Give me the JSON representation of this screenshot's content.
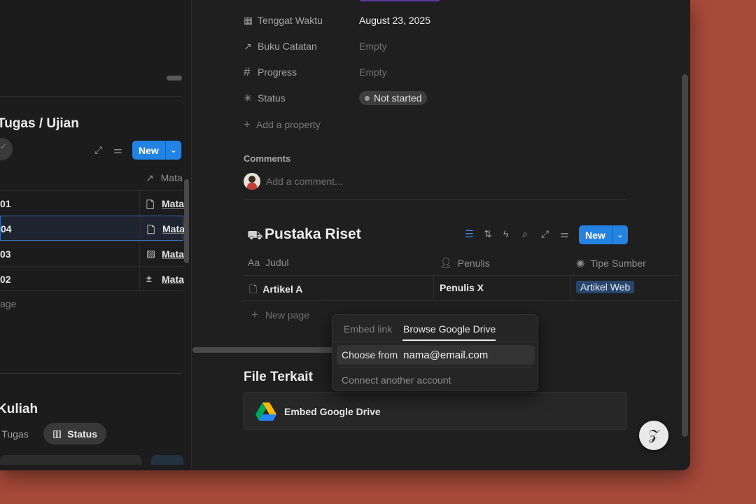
{
  "left_pane": {
    "title": "Tugas / Ujian",
    "new_label": "New",
    "column_header": "Mata",
    "rows": [
      {
        "id": "01",
        "icon": "page-icon",
        "glyph": "🗋",
        "mata": "Mata"
      },
      {
        "id": "04",
        "icon": "page-icon",
        "glyph": "🗋",
        "mata": "Mata"
      },
      {
        "id": "03",
        "icon": "chart-icon",
        "glyph": "▨",
        "mata": "Mata"
      },
      {
        "id": "02",
        "icon": "calc-icon",
        "glyph": "±",
        "mata": "Mata"
      }
    ],
    "new_page_fragment": "age",
    "section2_title": "Kuliah",
    "filter_fragment": "r Tugas",
    "status_pill": "Status"
  },
  "properties": [
    {
      "icon": "calendar-icon",
      "glyph": "▦",
      "name": "Tenggat Waktu",
      "value": "August 23, 2025",
      "empty": false
    },
    {
      "icon": "arrow-up-right-icon",
      "glyph": "↗",
      "name": "Buku Catatan",
      "value": "Empty",
      "empty": true
    },
    {
      "icon": "hash-icon",
      "glyph": "#",
      "name": "Progress",
      "value": "Empty",
      "empty": true
    }
  ],
  "status_prop": {
    "name": "Status",
    "value": "Not started"
  },
  "add_property": "Add a property",
  "comments": {
    "label": "Comments",
    "placeholder": "Add a comment..."
  },
  "database": {
    "title": "Pustaka Riset",
    "new_label": "New",
    "columns": [
      {
        "icon": "Aa",
        "name": "Judul"
      },
      {
        "icon": "person-icon",
        "name": "Penulis"
      },
      {
        "icon": "select-icon",
        "name": "Tipe Sumber"
      }
    ],
    "row": {
      "judul": "Artikel A",
      "penulis": "Penulis X",
      "tipe": "Artikel Web"
    },
    "new_page": "New page"
  },
  "file_section": {
    "title": "File Terkait",
    "block_label": "Embed Google Drive"
  },
  "popup": {
    "tab_embed": "Embed link",
    "tab_browse": "Browse Google Drive",
    "choose_label": "Choose from",
    "account": "nama@email.com",
    "connect": "Connect another account"
  },
  "colors": {
    "accent": "#2383e2",
    "background": "#1f1f1f",
    "desktop": "#a84a3a",
    "tag": "#28456c"
  }
}
